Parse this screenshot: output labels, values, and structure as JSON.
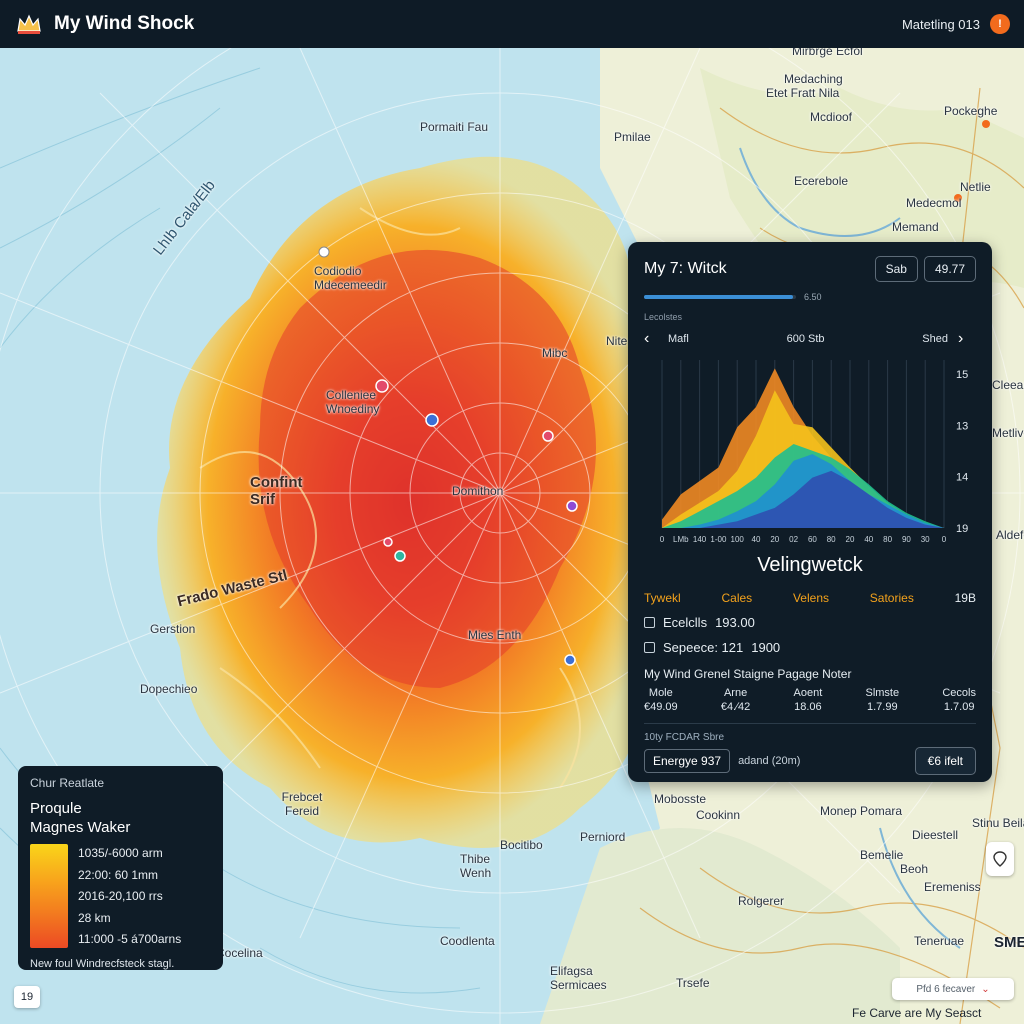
{
  "header": {
    "title": "My Wind Shock",
    "status": "Matetling 013",
    "logo_icon": "crown-logo-icon"
  },
  "map": {
    "labels": {
      "lhb": "LhIb Cala/Elb",
      "mirbrge": "Mirbrge Ecfol",
      "medaching": "Medaching",
      "eiet_fret": "Etet Fratt Nila",
      "modioof": "Mcdioof",
      "packeghe": "Pockeghe",
      "pormaiti": "Pormaiti Fau",
      "pmilae": "Pmilae",
      "ecerebole": "Ecerebole",
      "netlie": "Netlie",
      "medecmol": "Medecmol",
      "memand": "Memand",
      "codiodio": "Codiodio Mdecemeedir",
      "mibc": "Mibc",
      "nite": "Nite",
      "colleniee": "Colleniee Wnoediny",
      "confint": "Confint Srif",
      "domithon": "Domithon",
      "frado_waste": "Frado Waste Stl",
      "gerstion": "Gerstion",
      "mies_enth": "Mies Enth",
      "dopechieo": "Dopechieo",
      "frebcet": "Frebcet Fereid",
      "mobosste": "Mobosste",
      "cookinn": "Cookinn",
      "monep": "Monep Pomara",
      "dicestell": "Dieestell",
      "bemelie": "Bemelie",
      "eremeniss": "Eremeniss",
      "stinu": "Stinu Beilas",
      "perniord": "Perniord",
      "bocitibo": "Bocitibo",
      "thide": "Thibe Wenh",
      "coodlenta": "Coodlenta",
      "elifagsa": "Elifagsa Sermicaes",
      "cocelina": "Cocelina",
      "rolgerer": "Rolgerer",
      "trsefe": "Trsefe",
      "beoh": "Beoh",
      "teneruae": "Teneruae",
      "cleeanel": "Cleeanel",
      "metlivos": "Metlivos",
      "aldefo": "Aldefo",
      "swi": "SME"
    }
  },
  "panel": {
    "title": "My 7: Witck",
    "chip_a": "Sab",
    "chip_b": "49.77",
    "progress_label": "6.50",
    "progress_value": 0.98,
    "tiny_label": "Lecolstes",
    "chart_head_left": "Mafl",
    "chart_head_center": "600 Stb",
    "chart_head_right": "Shed",
    "prev_icon": "chevron-left-icon",
    "next_icon": "chevron-right-icon",
    "section_title": "Velingwetck",
    "series_labels": [
      "Tywekl",
      "Cales",
      "Velens",
      "Satories"
    ],
    "series_count": "19B",
    "checks": [
      {
        "label": "Ecelclls",
        "value": "193.00"
      },
      {
        "label": "Sepeece:  121",
        "value": "1900"
      }
    ],
    "note": "My Wind Grenel Staigne Pagage Noter",
    "stats": [
      {
        "label": "Mole",
        "value": "€49.09"
      },
      {
        "label": "Arne",
        "value": "€4.∕42"
      },
      {
        "label": "Aoent",
        "value": "18.06"
      },
      {
        "label": "Slmste",
        "value": "1.7.99"
      },
      {
        "label": "Cecols",
        "value": "1.7.09"
      }
    ],
    "foot_label": "10ty FCDAR Sbre",
    "foot_chip": "Energye 937",
    "foot_text": "adand (20m)",
    "foot_button": "€6 ifelt"
  },
  "chart_data": {
    "type": "area",
    "x": [
      0,
      1,
      2,
      3,
      4,
      5,
      6,
      7,
      8,
      9,
      10,
      11,
      12,
      13,
      14,
      15
    ],
    "x_tick_labels": [
      "0",
      "LMb",
      "140",
      "1-00",
      "100",
      "40",
      "20",
      "02",
      "60",
      "80",
      "20",
      "40",
      "80",
      "90",
      "30",
      "0"
    ],
    "y_tick_labels_right": [
      "15",
      "13",
      "14",
      "19"
    ],
    "series": [
      {
        "color": "#f08a24",
        "values": [
          0.05,
          0.2,
          0.28,
          0.36,
          0.6,
          0.72,
          0.95,
          0.72,
          0.55,
          0.42,
          0.3,
          0.22,
          0.12,
          0.06,
          0.02,
          0.0
        ]
      },
      {
        "color": "#f4c21c",
        "values": [
          0.0,
          0.08,
          0.15,
          0.22,
          0.34,
          0.55,
          0.82,
          0.62,
          0.6,
          0.48,
          0.36,
          0.25,
          0.15,
          0.08,
          0.03,
          0.0
        ]
      },
      {
        "color": "#1fbf8f",
        "values": [
          0.0,
          0.04,
          0.1,
          0.16,
          0.22,
          0.3,
          0.42,
          0.5,
          0.46,
          0.42,
          0.35,
          0.26,
          0.16,
          0.09,
          0.04,
          0.0
        ]
      },
      {
        "color": "#1f8fd0",
        "values": [
          0.0,
          0.0,
          0.02,
          0.05,
          0.1,
          0.16,
          0.26,
          0.4,
          0.44,
          0.38,
          0.28,
          0.2,
          0.14,
          0.08,
          0.03,
          0.0
        ]
      },
      {
        "color": "#2f4fb0",
        "values": [
          0.0,
          0.0,
          0.0,
          0.02,
          0.04,
          0.08,
          0.12,
          0.2,
          0.3,
          0.34,
          0.28,
          0.2,
          0.12,
          0.06,
          0.02,
          0.0
        ]
      }
    ],
    "ylim": [
      0,
      1
    ]
  },
  "legend": {
    "subtitle": "Chur Reatlate",
    "title_1": "Proqule",
    "title_2": "Magnes Waker",
    "rows": [
      "1035/-6000 arm",
      "22:00: 60 1mm",
      "2016-20,100 rrs",
      "28 km",
      "11:000 -5 á700arns"
    ],
    "footer": "New foul Windrecfsteck stagl.",
    "colors": [
      "#f9d51a",
      "#f8a51c",
      "#f37d1f",
      "#ec4a24"
    ]
  },
  "corner": {
    "zoom": "19",
    "search": "Pfd 6 fecaver",
    "search_icon": "chevron-down-icon",
    "footer": "Fe Carve are My Seasct",
    "ctrl_icon": "pin-icon"
  },
  "colors": {
    "ocean": "#bfe3ee",
    "panel": "#0f1c27",
    "accent": "#f3a21c"
  }
}
